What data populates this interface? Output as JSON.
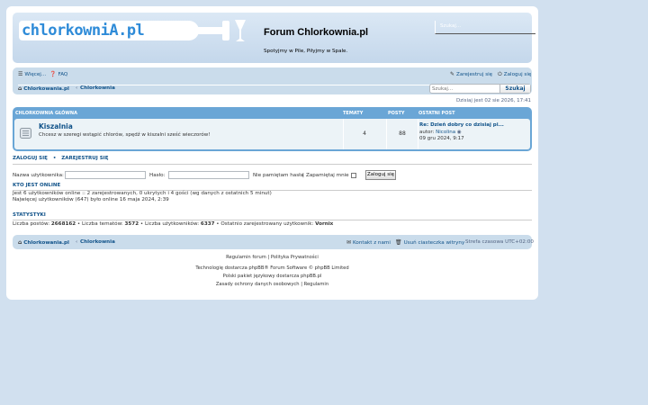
{
  "header": {
    "logo_text": "chlorkowniA.pl",
    "title": "Forum Chlorkownia.pl",
    "description": "Spotyjmy w Pile, Piłyjmy w Spale.",
    "search_placeholder": "Szukaj..."
  },
  "nav": {
    "more": "Więcej...",
    "faq": "FAQ",
    "register": "Zarejestruj się",
    "login": "Zaloguj się",
    "breadcrumb_home": "Chlorkowania.pl",
    "breadcrumb_current": "Chlorkownia",
    "search_placeholder": "Szukaj...",
    "search_button": "Szukaj",
    "date": "Dzisiaj jest 02 sie 2026, 17:41"
  },
  "forum_table": {
    "headers": {
      "main": "Chlorkownia główna",
      "topics": "Tematy",
      "posts": "Posty",
      "last_post": "Ostatni post"
    },
    "row": {
      "name": "Kiszalnia",
      "description": "Chcesz w szeregi wstąpić chlorów, spędź w kiszalni sześć wieczorów!",
      "topics": "4",
      "posts": "88",
      "last_title": "Re: Dzień dobry co dzisiaj pi...",
      "last_author_prefix": "autor:",
      "last_author": "Nicolina",
      "last_date": "09 gru 2024, 9:17"
    }
  },
  "login": {
    "title_login": "Zaloguj się",
    "separator": "•",
    "title_register": "Zarejestruj się",
    "username_label": "Nazwa użytkownika:",
    "password_label": "Hasło:",
    "forgot": "Nie pamiętam hasła",
    "remember": "Zapamiętaj mnie",
    "button": "Zaloguj się"
  },
  "online": {
    "title": "Kto jest online",
    "line1": "Jest 6 użytkowników online :: 2 zarejestrowanych, 0 ukrytych i 4 gości (wg danych z ostatnich 5 minut)",
    "line2": "Najwięcej użytkowników (647) było online 16 maja 2024, 2:39"
  },
  "stats": {
    "title": "Statystyki",
    "posts_label": "Liczba postów:",
    "posts": "2668162",
    "topics_label": "Liczba tematów:",
    "topics": "3572",
    "users_label": "Liczba użytkowników:",
    "users": "6337",
    "newest_label": "Ostatnio zarejestrowany użytkownik:",
    "newest": "Vornix"
  },
  "bottom_nav": {
    "home": "Chlorkowania.pl",
    "current": "Chlorkownia",
    "contact": "Kontakt z nami",
    "cookies": "Usuń ciasteczka witryny",
    "timezone": "Strefa czasowa UTC+02:00"
  },
  "footer": {
    "links": "Regulamin forum | Polityka Prywatności",
    "powered": "Technologię dostarcza phpBB® Forum Software © phpBB Limited",
    "lang": "Polski pakiet językowy dostarcza phpBB.pl",
    "privacy": "Zasady ochrony danych osobowych | Regulamin"
  }
}
